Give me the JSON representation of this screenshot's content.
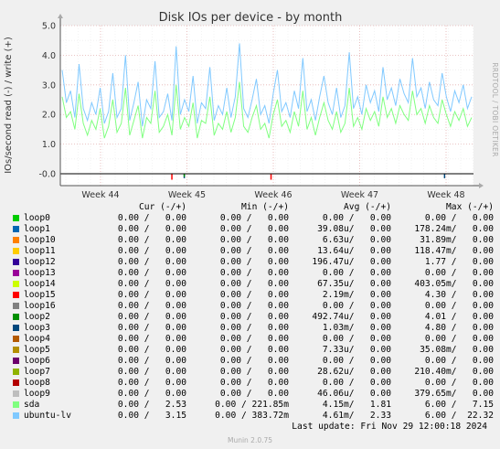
{
  "title": "Disk IOs per device - by month",
  "side_label": "RRDTOOL / TOBI OETIKER",
  "footer": "Munin 2.0.75",
  "last_update": "Last update: Fri Nov 29 12:00:18 2024",
  "legend": {
    "headers": [
      "Cur (-/+)",
      "Min (-/+)",
      "Avg (-/+)",
      "Max (-/+)"
    ],
    "rows": [
      {
        "name": "loop0",
        "color": "#00cc00",
        "cur": "0.00 /   0.00",
        "min": "0.00 /   0.00",
        "avg": "0.00 /   0.00",
        "max": "0.00 /   0.00"
      },
      {
        "name": "loop1",
        "color": "#0066b3",
        "cur": "0.00 /   0.00",
        "min": "0.00 /   0.00",
        "avg": "39.08u/   0.00",
        "max": "178.24m/   0.00"
      },
      {
        "name": "loop10",
        "color": "#ff8000",
        "cur": "0.00 /   0.00",
        "min": "0.00 /   0.00",
        "avg": "6.63u/   0.00",
        "max": "31.89m/   0.00"
      },
      {
        "name": "loop11",
        "color": "#ffcc00",
        "cur": "0.00 /   0.00",
        "min": "0.00 /   0.00",
        "avg": "13.64u/   0.00",
        "max": "118.47m/   0.00"
      },
      {
        "name": "loop12",
        "color": "#330099",
        "cur": "0.00 /   0.00",
        "min": "0.00 /   0.00",
        "avg": "196.47u/   0.00",
        "max": "1.77 /   0.00"
      },
      {
        "name": "loop13",
        "color": "#990099",
        "cur": "0.00 /   0.00",
        "min": "0.00 /   0.00",
        "avg": "0.00 /   0.00",
        "max": "0.00 /   0.00"
      },
      {
        "name": "loop14",
        "color": "#ccff00",
        "cur": "0.00 /   0.00",
        "min": "0.00 /   0.00",
        "avg": "67.35u/   0.00",
        "max": "403.05m/   0.00"
      },
      {
        "name": "loop15",
        "color": "#ff0000",
        "cur": "0.00 /   0.00",
        "min": "0.00 /   0.00",
        "avg": "2.19m/   0.00",
        "max": "4.30 /   0.00"
      },
      {
        "name": "loop16",
        "color": "#808080",
        "cur": "0.00 /   0.00",
        "min": "0.00 /   0.00",
        "avg": "0.00 /   0.00",
        "max": "0.00 /   0.00"
      },
      {
        "name": "loop2",
        "color": "#008f00",
        "cur": "0.00 /   0.00",
        "min": "0.00 /   0.00",
        "avg": "492.74u/   0.00",
        "max": "4.01 /   0.00"
      },
      {
        "name": "loop3",
        "color": "#00487d",
        "cur": "0.00 /   0.00",
        "min": "0.00 /   0.00",
        "avg": "1.03m/   0.00",
        "max": "4.80 /   0.00"
      },
      {
        "name": "loop4",
        "color": "#b35a00",
        "cur": "0.00 /   0.00",
        "min": "0.00 /   0.00",
        "avg": "0.00 /   0.00",
        "max": "0.00 /   0.00"
      },
      {
        "name": "loop5",
        "color": "#b38f00",
        "cur": "0.00 /   0.00",
        "min": "0.00 /   0.00",
        "avg": "7.33u/   0.00",
        "max": "35.08m/   0.00"
      },
      {
        "name": "loop6",
        "color": "#6b006b",
        "cur": "0.00 /   0.00",
        "min": "0.00 /   0.00",
        "avg": "0.00 /   0.00",
        "max": "0.00 /   0.00"
      },
      {
        "name": "loop7",
        "color": "#8fb300",
        "cur": "0.00 /   0.00",
        "min": "0.00 /   0.00",
        "avg": "28.62u/   0.00",
        "max": "210.40m/   0.00"
      },
      {
        "name": "loop8",
        "color": "#b30000",
        "cur": "0.00 /   0.00",
        "min": "0.00 /   0.00",
        "avg": "0.00 /   0.00",
        "max": "0.00 /   0.00"
      },
      {
        "name": "loop9",
        "color": "#bebebe",
        "cur": "0.00 /   0.00",
        "min": "0.00 /   0.00",
        "avg": "46.06u/   0.00",
        "max": "379.65m/   0.00"
      },
      {
        "name": "sda",
        "color": "#80ff80",
        "cur": "0.00 /   2.53",
        "min": "0.00 / 221.85m",
        "avg": "4.15m/   1.81",
        "max": "6.00 /   7.15"
      },
      {
        "name": "ubuntu-lv",
        "color": "#80c9ff",
        "cur": "0.00 /   3.15",
        "min": "0.00 / 383.72m",
        "avg": "4.61m/   2.33",
        "max": "6.00 /  22.32"
      }
    ]
  },
  "chart_data": {
    "type": "line",
    "title": "Disk IOs per device - by month",
    "ylabel": "IOs/second read (-) / write (+)",
    "ylim": [
      -0.4,
      5.0
    ],
    "yticks": [
      "-0.0",
      "1.0",
      "2.0",
      "3.0",
      "4.0",
      "5.0"
    ],
    "xticks": [
      "Week 44",
      "Week 45",
      "Week 46",
      "Week 47",
      "Week 48"
    ],
    "grid": true,
    "series": [
      {
        "name": "ubuntu-lv",
        "color": "#80c9ff",
        "values": [
          3.5,
          2.4,
          2.8,
          1.9,
          3.7,
          2.2,
          1.8,
          2.4,
          2.0,
          2.9,
          1.7,
          2.1,
          3.4,
          1.9,
          2.2,
          4.0,
          1.8,
          2.4,
          3.1,
          1.6,
          2.5,
          2.2,
          3.8,
          1.9,
          2.1,
          2.7,
          1.8,
          4.3,
          2.0,
          2.5,
          2.1,
          3.3,
          1.7,
          2.4,
          2.2,
          3.6,
          1.8,
          2.3,
          2.0,
          2.9,
          1.9,
          2.6,
          4.4,
          2.2,
          1.9,
          2.5,
          3.2,
          2.0,
          2.3,
          1.7,
          2.7,
          3.5,
          2.1,
          2.4,
          1.9,
          2.8,
          2.2,
          3.9,
          2.1,
          2.5,
          1.8,
          2.6,
          3.3,
          2.4,
          2.0,
          2.9,
          1.9,
          2.3,
          4.1,
          2.2,
          2.6,
          2.0,
          3.0,
          2.4,
          2.8,
          2.1,
          3.6,
          2.5,
          2.9,
          2.3,
          3.2,
          2.7,
          2.4,
          3.9,
          2.6,
          2.9,
          2.2,
          3.1,
          2.5,
          2.3,
          3.4,
          2.6,
          2.1,
          2.8,
          2.4,
          3.0,
          2.2,
          2.6
        ]
      },
      {
        "name": "sda",
        "color": "#80ff80",
        "values": [
          2.6,
          1.9,
          2.1,
          1.5,
          2.7,
          1.7,
          1.3,
          1.8,
          1.5,
          2.2,
          1.2,
          1.6,
          2.5,
          1.4,
          1.7,
          2.9,
          1.3,
          1.8,
          2.3,
          1.2,
          1.9,
          1.7,
          2.8,
          1.4,
          1.6,
          2.0,
          1.3,
          3.0,
          1.5,
          1.9,
          1.6,
          2.4,
          1.2,
          1.8,
          1.7,
          2.6,
          1.3,
          1.7,
          1.5,
          2.1,
          1.4,
          1.9,
          3.1,
          1.6,
          1.4,
          1.9,
          2.3,
          1.5,
          1.7,
          1.2,
          2.0,
          2.5,
          1.6,
          1.8,
          1.4,
          2.1,
          1.6,
          2.8,
          1.5,
          1.9,
          1.3,
          1.9,
          2.4,
          1.8,
          1.5,
          2.1,
          1.4,
          1.7,
          2.9,
          1.6,
          1.9,
          1.5,
          2.2,
          1.8,
          2.1,
          1.6,
          2.6,
          1.9,
          2.2,
          1.7,
          2.3,
          2.0,
          1.8,
          2.8,
          2.0,
          2.2,
          1.7,
          2.3,
          1.9,
          1.7,
          2.5,
          2.0,
          1.6,
          2.1,
          1.8,
          2.2,
          1.6,
          1.9
        ]
      }
    ],
    "spikes": [
      {
        "name": "loop15",
        "color": "#ff0000",
        "positions": [
          0.27,
          0.51
        ],
        "values": [
          -0.2,
          -0.2
        ]
      },
      {
        "name": "loop3",
        "color": "#00487d",
        "positions": [
          0.3,
          0.93
        ],
        "values": [
          -0.15,
          -0.15
        ]
      },
      {
        "name": "loop2",
        "color": "#008f00",
        "positions": [
          0.3
        ],
        "values": [
          -0.1
        ]
      }
    ]
  }
}
